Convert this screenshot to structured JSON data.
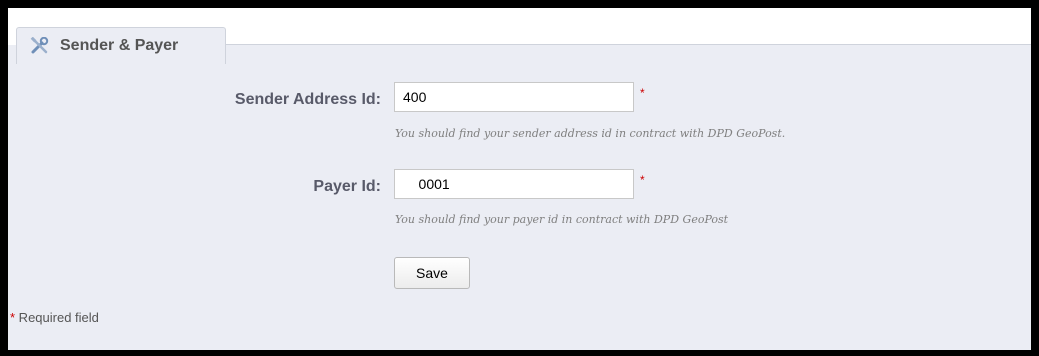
{
  "section": {
    "title": "Sender & Payer",
    "icon": "tools-icon"
  },
  "fields": {
    "sender_address": {
      "label": "Sender Address Id:",
      "value": "400",
      "hint": "You should find your sender address id in contract with DPD GeoPost."
    },
    "payer": {
      "label": "Payer Id:",
      "value": "    0001",
      "hint": "You should find your payer id in contract with DPD GeoPost"
    }
  },
  "required_marker": "*",
  "save_label": "Save",
  "footnote": {
    "star": "*",
    "text": " Required field"
  },
  "colors": {
    "panel_bg": "#ebedf4",
    "label": "#585a69",
    "required": "#cc0000",
    "hint": "#7f7f7f"
  }
}
